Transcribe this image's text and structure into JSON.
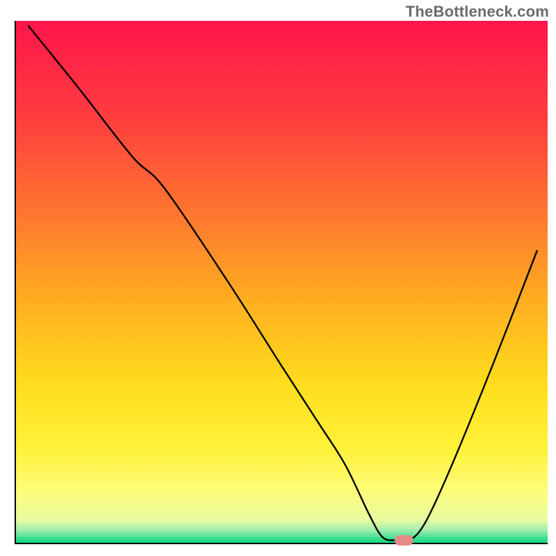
{
  "watermark": "TheBottleneck.com",
  "chart_data": {
    "type": "line",
    "title": "",
    "xlabel": "",
    "ylabel": "",
    "xlim": [
      0,
      100
    ],
    "ylim": [
      0,
      100
    ],
    "grid": false,
    "legend": false,
    "background_gradient_stops": [
      {
        "offset": 0.0,
        "color": "#ff154a"
      },
      {
        "offset": 0.18,
        "color": "#ff3c3f"
      },
      {
        "offset": 0.38,
        "color": "#ff7a2e"
      },
      {
        "offset": 0.55,
        "color": "#ffb21f"
      },
      {
        "offset": 0.7,
        "color": "#ffde1e"
      },
      {
        "offset": 0.82,
        "color": "#fff23a"
      },
      {
        "offset": 0.9,
        "color": "#fdfd7a"
      },
      {
        "offset": 0.955,
        "color": "#e8fba0"
      },
      {
        "offset": 0.975,
        "color": "#9eecad"
      },
      {
        "offset": 0.992,
        "color": "#2fdc8a"
      },
      {
        "offset": 1.0,
        "color": "#14d67f"
      }
    ],
    "series": [
      {
        "name": "bottleneck-curve",
        "type": "line",
        "color": "#000000",
        "x": [
          2.5,
          12,
          22,
          28,
          40,
          50,
          57,
          62,
          66.5,
          69,
          71.5,
          74,
          77,
          82,
          90,
          98
        ],
        "y": [
          99,
          87,
          74,
          68,
          50,
          34,
          23,
          15,
          5.5,
          1.2,
          0.6,
          0.6,
          4,
          15,
          35,
          56
        ]
      }
    ],
    "marker": {
      "name": "optimal-point",
      "x": 73,
      "y": 0.6,
      "width": 3.5,
      "height": 2.0,
      "color": "#e78b87"
    },
    "axes": {
      "show_ticks": false,
      "line_color": "#000000",
      "line_width": 2
    }
  }
}
